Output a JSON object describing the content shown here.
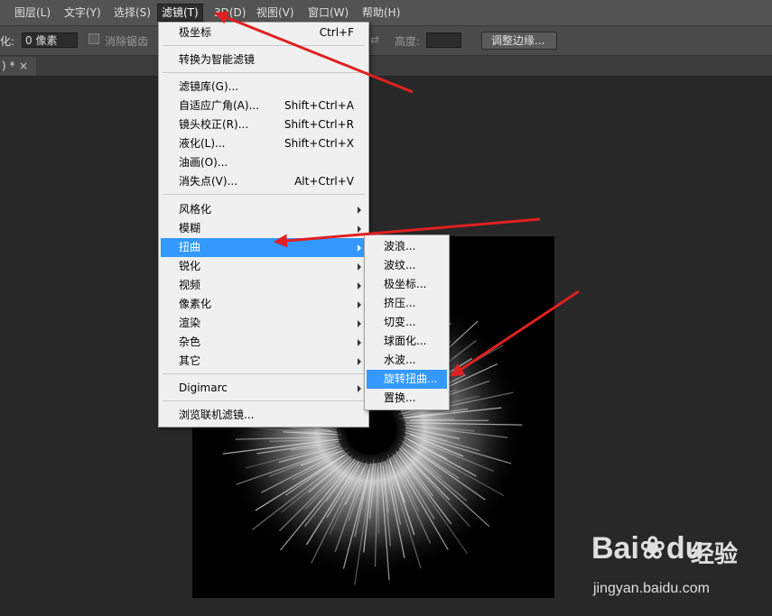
{
  "menubar": {
    "items": [
      "图层(L)",
      "文字(Y)",
      "选择(S)",
      "滤镜(T)",
      "3D(D)",
      "视图(V)",
      "窗口(W)",
      "帮助(H)"
    ]
  },
  "options": {
    "feather_label": "化:",
    "feather_value": "0 像素",
    "antialias_label": "消除锯齿",
    "height_label": "高度:",
    "refine_edge_button": "调整边缘..."
  },
  "tab": {
    "title": ") *",
    "close": "×"
  },
  "filter_menu": {
    "polar": {
      "label": "极坐标",
      "shortcut": "Ctrl+F"
    },
    "smart": {
      "label": "转换为智能滤镜"
    },
    "gallery": {
      "label": "滤镜库(G)..."
    },
    "adaptive": {
      "label": "自适应广角(A)...",
      "shortcut": "Shift+Ctrl+A"
    },
    "lens": {
      "label": "镜头校正(R)...",
      "shortcut": "Shift+Ctrl+R"
    },
    "liquify": {
      "label": "液化(L)...",
      "shortcut": "Shift+Ctrl+X"
    },
    "oil": {
      "label": "油画(O)..."
    },
    "vanish": {
      "label": "消失点(V)...",
      "shortcut": "Alt+Ctrl+V"
    },
    "submenus": [
      "风格化",
      "模糊",
      "扭曲",
      "锐化",
      "视频",
      "像素化",
      "渲染",
      "杂色",
      "其它"
    ],
    "digimarc": {
      "label": "Digimarc"
    },
    "browse": {
      "label": "浏览联机滤镜..."
    }
  },
  "distort_submenu": {
    "items": [
      "波浪...",
      "波纹...",
      "极坐标...",
      "挤压...",
      "切变...",
      "球面化...",
      "水波...",
      "旋转扭曲...",
      "置换..."
    ]
  },
  "watermark": {
    "brand": "Bai",
    "brand_suffix": "du",
    "cn": "经验",
    "url": "jingyan.baidu.com"
  },
  "colors": {
    "highlight": "#3399ff",
    "arrow": "#e02020",
    "menubar": "#535353",
    "workspace": "#282828"
  }
}
